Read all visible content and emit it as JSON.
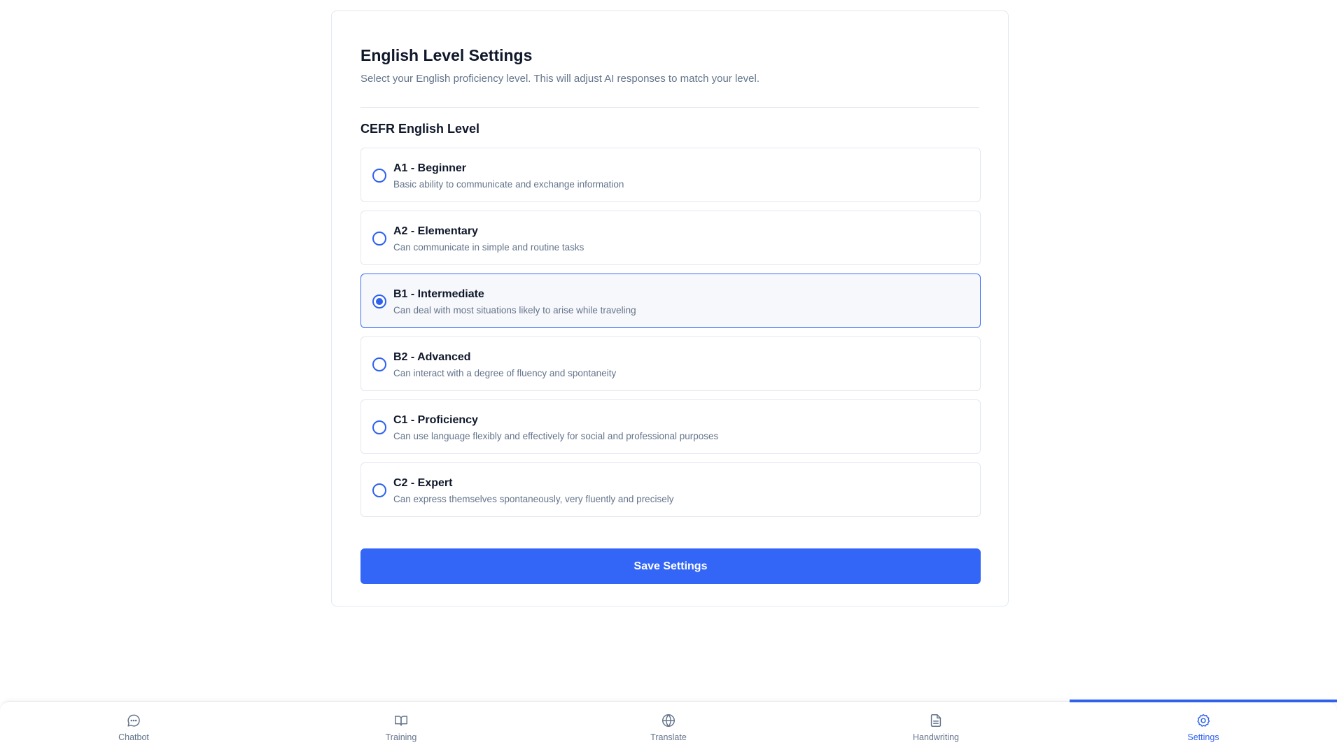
{
  "card": {
    "title": "English Level Settings",
    "subtitle": "Select your English proficiency level. This will adjust AI responses to match your level.",
    "section_title": "CEFR English Level"
  },
  "levels": [
    {
      "label": "A1 - Beginner",
      "description": "Basic ability to communicate and exchange information",
      "selected": false
    },
    {
      "label": "A2 - Elementary",
      "description": "Can communicate in simple and routine tasks",
      "selected": false
    },
    {
      "label": "B1 - Intermediate",
      "description": "Can deal with most situations likely to arise while traveling",
      "selected": true
    },
    {
      "label": "B2 - Advanced",
      "description": "Can interact with a degree of fluency and spontaneity",
      "selected": false
    },
    {
      "label": "C1 - Proficiency",
      "description": "Can use language flexibly and effectively for social and professional purposes",
      "selected": false
    },
    {
      "label": "C2 - Expert",
      "description": "Can express themselves spontaneously, very fluently and precisely",
      "selected": false
    }
  ],
  "save_button": {
    "label": "Save Settings"
  },
  "nav": {
    "items": [
      {
        "label": "Chatbot",
        "icon": "chat-bubble-icon",
        "active": false
      },
      {
        "label": "Training",
        "icon": "book-icon",
        "active": false
      },
      {
        "label": "Translate",
        "icon": "globe-icon",
        "active": false
      },
      {
        "label": "Handwriting",
        "icon": "document-icon",
        "active": false
      },
      {
        "label": "Settings",
        "icon": "gear-icon",
        "active": true
      }
    ]
  },
  "colors": {
    "accent": "#3366f6",
    "radio": "#2f62ec",
    "muted_text": "#64748b",
    "border": "#e2e8f0",
    "selected_bg": "#f7f8fb"
  }
}
